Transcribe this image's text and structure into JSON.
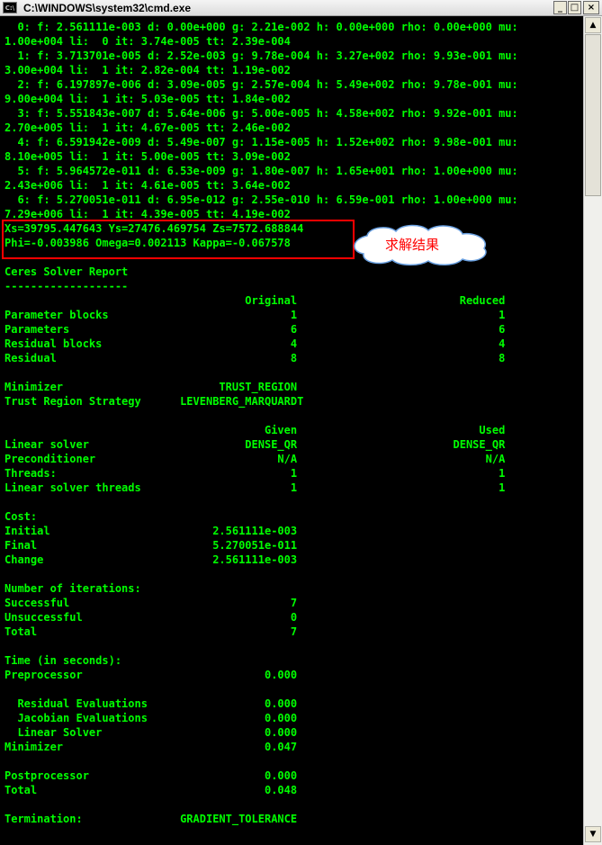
{
  "window": {
    "title": "C:\\WINDOWS\\system32\\cmd.exe",
    "icon_label": "C:\\",
    "buttons": {
      "minimize": "_",
      "maximize": "□",
      "close": "×"
    }
  },
  "console": {
    "lines": [
      "  0: f: 2.561111e-003 d: 0.00e+000 g: 2.21e-002 h: 0.00e+000 rho: 0.00e+000 mu:",
      "1.00e+004 li:  0 it: 3.74e-005 tt: 2.39e-004",
      "  1: f: 3.713701e-005 d: 2.52e-003 g: 9.78e-004 h: 3.27e+002 rho: 9.93e-001 mu:",
      "3.00e+004 li:  1 it: 2.82e-004 tt: 1.19e-002",
      "  2: f: 6.197897e-006 d: 3.09e-005 g: 2.57e-004 h: 5.49e+002 rho: 9.78e-001 mu:",
      "9.00e+004 li:  1 it: 5.03e-005 tt: 1.84e-002",
      "  3: f: 5.551843e-007 d: 5.64e-006 g: 5.00e-005 h: 4.58e+002 rho: 9.92e-001 mu:",
      "2.70e+005 li:  1 it: 4.67e-005 tt: 2.46e-002",
      "  4: f: 6.591942e-009 d: 5.49e-007 g: 1.15e-005 h: 1.52e+002 rho: 9.98e-001 mu:",
      "8.10e+005 li:  1 it: 5.00e-005 tt: 3.09e-002",
      "  5: f: 5.964572e-011 d: 6.53e-009 g: 1.80e-007 h: 1.65e+001 rho: 1.00e+000 mu:",
      "2.43e+006 li:  1 it: 4.61e-005 tt: 3.64e-002",
      "  6: f: 5.270051e-011 d: 6.95e-012 g: 2.55e-010 h: 6.59e-001 rho: 1.00e+000 mu:",
      "7.29e+006 li:  1 it: 4.39e-005 tt: 4.19e-002",
      "Xs=39795.447643 Ys=27476.469754 Zs=7572.688844",
      "Phi=-0.003986 Omega=0.002113 Kappa=-0.067578",
      "",
      "Ceres Solver Report",
      "-------------------",
      "                                     Original                         Reduced",
      "Parameter blocks                            1                               1",
      "Parameters                                  6                               6",
      "Residual blocks                             4                               4",
      "Residual                                    8                               8",
      "",
      "Minimizer                        TRUST_REGION",
      "Trust Region Strategy      LEVENBERG_MARQUARDT",
      "",
      "                                        Given                            Used",
      "Linear solver                        DENSE_QR                        DENSE_QR",
      "Preconditioner                            N/A                             N/A",
      "Threads:                                    1                               1",
      "Linear solver threads                       1                               1",
      "",
      "Cost:",
      "Initial                         2.561111e-003",
      "Final                           5.270051e-011",
      "Change                          2.561111e-003",
      "",
      "Number of iterations:",
      "Successful                                  7",
      "Unsuccessful                                0",
      "Total                                       7",
      "",
      "Time (in seconds):",
      "Preprocessor                            0.000",
      "",
      "  Residual Evaluations                  0.000",
      "  Jacobian Evaluations                  0.000",
      "  Linear Solver                         0.000",
      "Minimizer                               0.047",
      "",
      "Postprocessor                           0.000",
      "Total                                   0.048",
      "",
      "Termination:               GRADIENT_TOLERANCE"
    ]
  },
  "annotation": {
    "callout_text": "求解结果",
    "box_color": "#ff0000"
  },
  "colors": {
    "console_bg": "#000000",
    "console_text": "#00ff00"
  },
  "scrollbar": {
    "up_arrow": "▲",
    "down_arrow": "▼"
  }
}
